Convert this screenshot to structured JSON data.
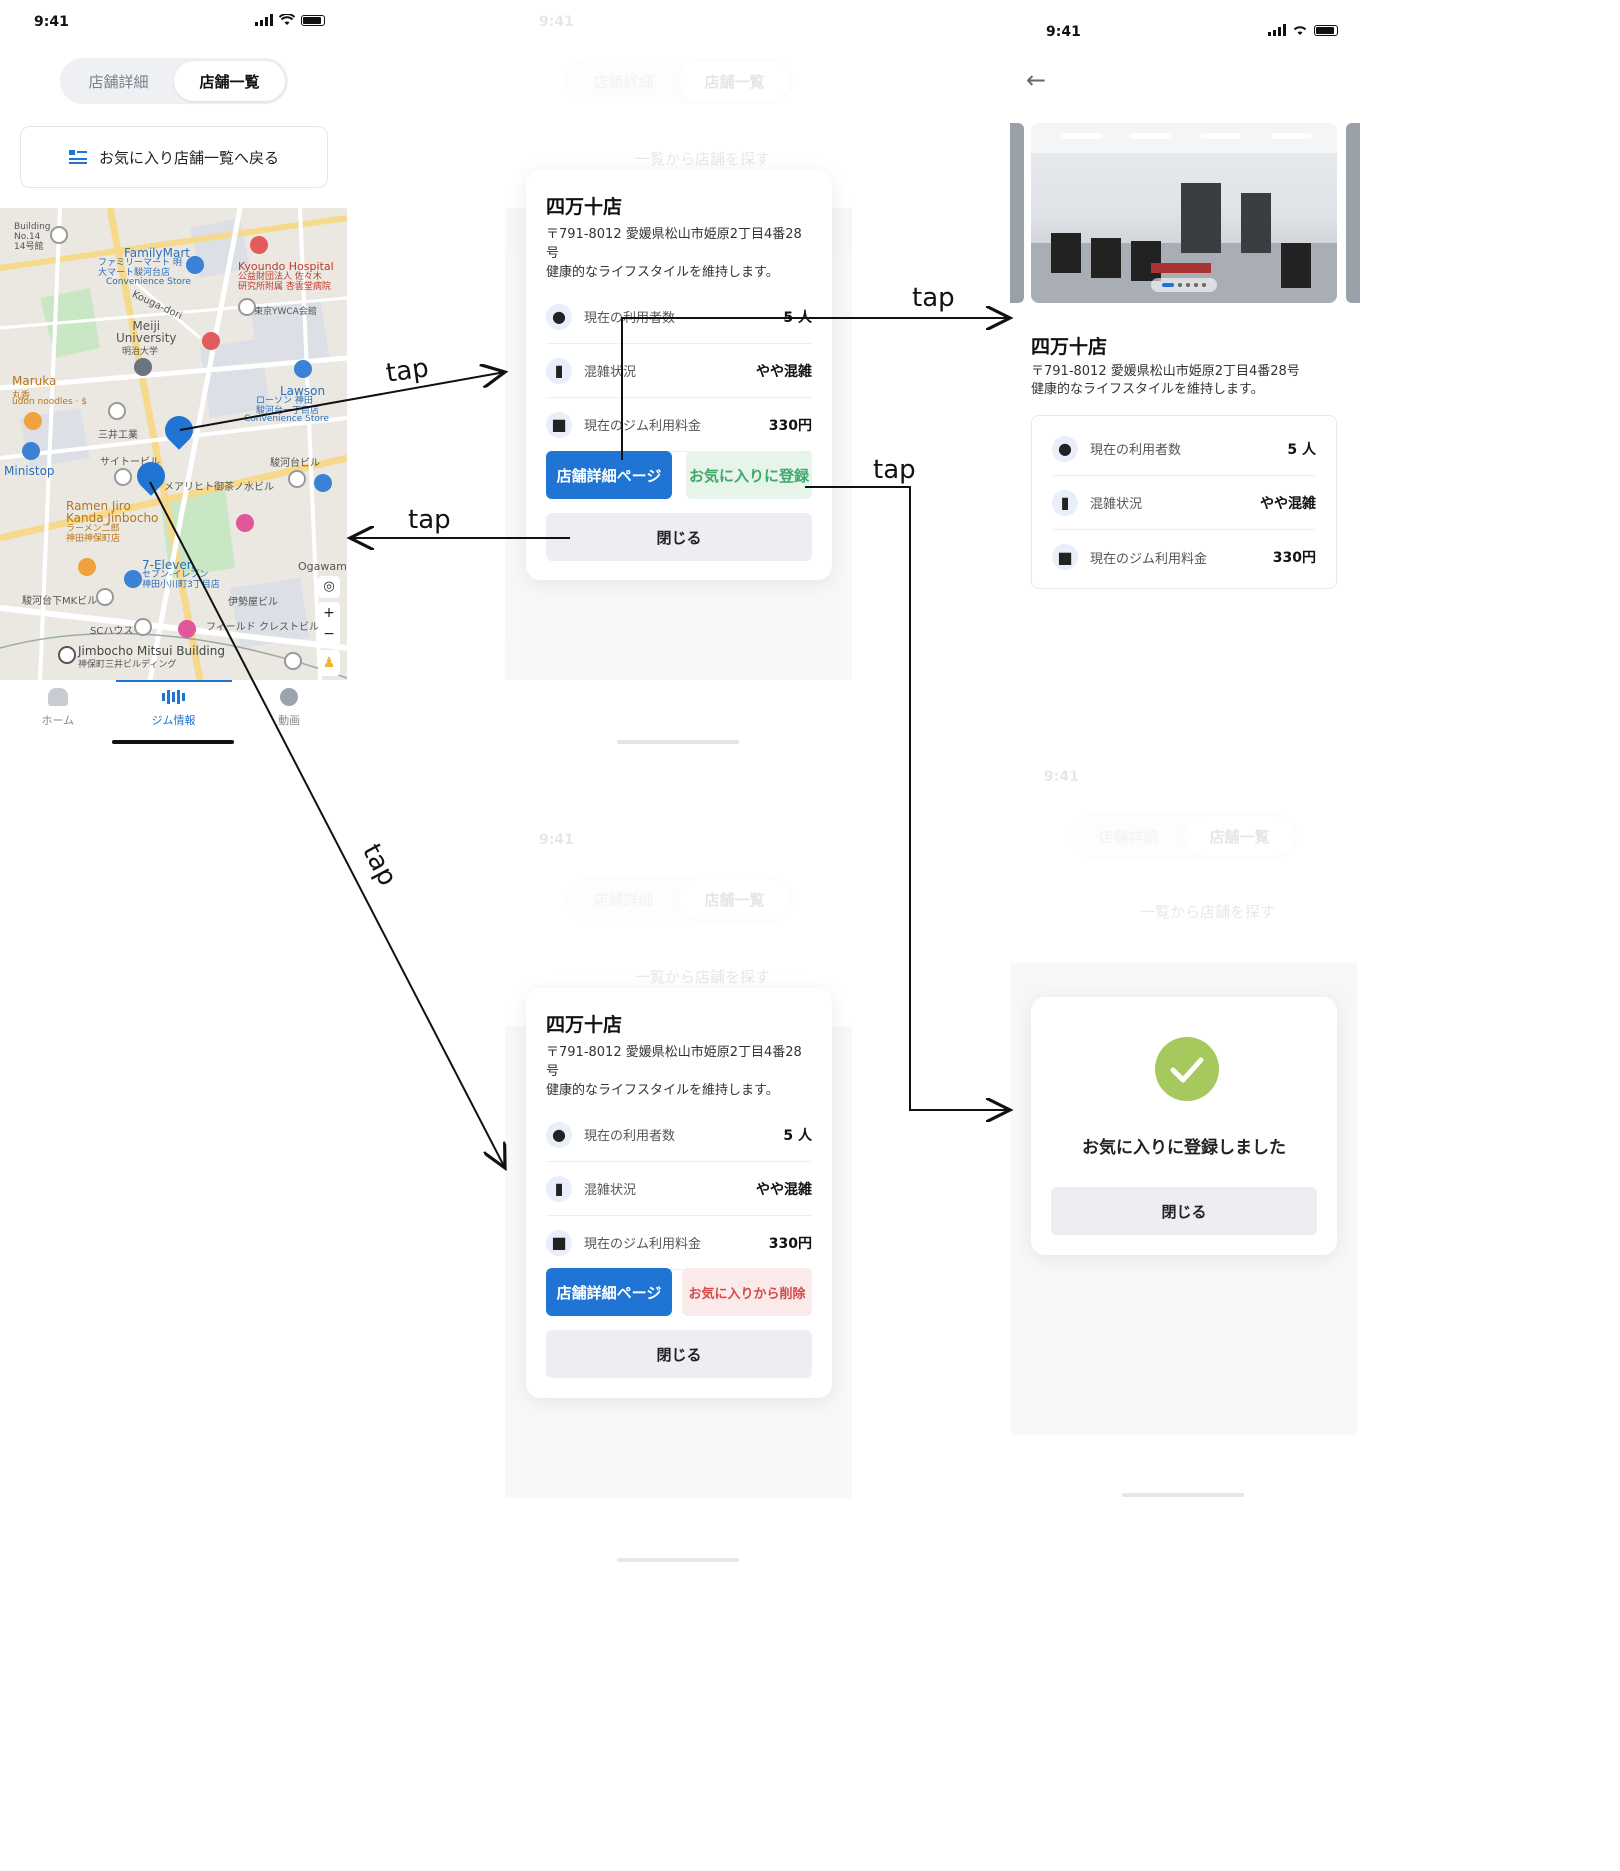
{
  "status": {
    "time": "9:41"
  },
  "segment": {
    "detail": "店舗詳細",
    "list": "店舗一覧"
  },
  "back_to_favorites": "お気に入り店舗一覧へ戻る",
  "search_from_list": "一覧から店舗を探す",
  "tabs": {
    "home": "ホーム",
    "gym": "ジム情報",
    "video": "動画"
  },
  "map_labels": {
    "building_no14": "Building\nNo.14\n14号館",
    "familymart": "FamilyMart",
    "familymart_jp": "ファミリーマート 明\n大マート駿河台店",
    "familymart_cs": "Convenience Store",
    "kyoundo": "Kyoundo Hospital",
    "kyoundo_jp": "公益財団法人 佐々木\n研究所附属 杏雲堂病院",
    "kouga": "Kouga-dori",
    "ywca": "東京YWCA会館",
    "meiji": "Meiji\nUniversity",
    "meiji_jp": "明治大学",
    "maruka": "Maruka",
    "maruka_jp": "丸香",
    "udon": "udon noodles · $",
    "lawson": "Lawson",
    "lawson_jp": "ローソン 神田\n駿河台一丁目店",
    "lawson_cs": "Convenience Store",
    "mitsui": "三井工業",
    "saito": "サイトービル",
    "suruga": "駿河台ビル",
    "ministop": "Ministop",
    "ramen": "Ramen Jiro\nKanda Jinbocho",
    "ramen_jp": "ラーメン二郎\n神田神保町店",
    "seven": "7-Eleven",
    "seven_jp": "セブン-イレブン\n神田小川町3丁目店",
    "mk": "駿河台下MKビル",
    "sc": "SCハウス",
    "field": "フィールド クレストビル",
    "iseya": "伊勢屋ビル",
    "jimbocho": "Jimbocho Mitsui Building",
    "jimbocho_jp": "神保町三井ビルディング",
    "ogawama": "Ogawama",
    "meariheto": "メアリヒト御茶ノ水ビル"
  },
  "shop": {
    "name": "四万十店",
    "address": "〒791-8012 愛媛県松山市姫原2丁目4番28号",
    "desc": "健康的なライフスタイルを維持します。",
    "rows": [
      {
        "icon": "users-icon",
        "label": "現在の利用者数",
        "value": "5 人"
      },
      {
        "icon": "bar-chart-icon",
        "label": "混雑状況",
        "value": "やや混雑"
      },
      {
        "icon": "wallet-icon",
        "label": "現在のジム利用料金",
        "value": "330円"
      }
    ]
  },
  "buttons": {
    "detail": "店舗詳細ページ",
    "fav_add": "お気に入りに登録",
    "fav_remove": "お気に入りから削除",
    "close": "閉じる"
  },
  "dialog": {
    "message": "お気に入りに登録しました",
    "close": "閉じる"
  },
  "annotations": {
    "tap": "tap"
  },
  "colors": {
    "primary": "#1f74d4",
    "fav_green": "#3ea96a",
    "danger": "#d64a4a",
    "success": "#a6c95e"
  }
}
